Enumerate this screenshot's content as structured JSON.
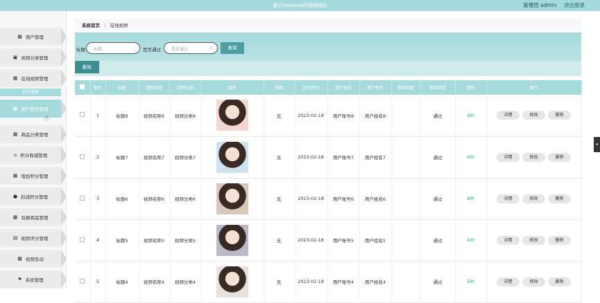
{
  "header": {
    "title": "基于Javaweb的视频网站",
    "user": "管理员 admin",
    "logout": "退出登录"
  },
  "sidebar": {
    "items": [
      {
        "label": "用户管理",
        "icon": "grid-icon"
      },
      {
        "label": "视频分类管理",
        "icon": "box-icon"
      },
      {
        "label": "在线视频管理",
        "icon": "grid-icon"
      },
      {
        "label": "用户积分管理",
        "icon": "grid-icon"
      },
      {
        "label": "商品分类管理",
        "icon": "grid-icon"
      },
      {
        "label": "积分商城管理",
        "icon": "shop-icon"
      },
      {
        "label": "增加积分管理",
        "icon": "grid-icon"
      },
      {
        "label": "扣减积分管理",
        "icon": "user-icon"
      },
      {
        "label": "兑换商品管理",
        "icon": "grid-icon"
      },
      {
        "label": "视频评分管理",
        "icon": "doc-icon"
      },
      {
        "label": "视频互动",
        "icon": "grid-icon"
      },
      {
        "label": "系统管理",
        "icon": "flag-icon"
      }
    ],
    "sub_label": "在线视频"
  },
  "breadcrumb": {
    "home": "系统首页",
    "sep": "⋮",
    "current": "在线视频"
  },
  "search": {
    "title_label": "标题",
    "title_placeholder": "标题",
    "pass_label": "是否通过",
    "pass_placeholder": "是否通过",
    "query": "查询"
  },
  "delete_label": "删除",
  "table": {
    "headers": [
      "索引",
      "标题",
      "视频名称",
      "视频分类",
      "图片",
      "视频",
      "发布时间",
      "用户账号",
      "用户姓名",
      "审核回复",
      "审核状态",
      "审核",
      "操作"
    ],
    "rows": [
      {
        "idx": "1",
        "title": "标题8",
        "name": "视频名称8",
        "cat": "视频分类8",
        "video": "无",
        "date": "2023-02-18",
        "acct": "用户账号8",
        "uname": "用户姓名8",
        "reply": "",
        "status": "通过",
        "audit": "审核"
      },
      {
        "idx": "2",
        "title": "标题7",
        "name": "视频名称7",
        "cat": "视频分类7",
        "video": "无",
        "date": "2023-02-18",
        "acct": "用户账号7",
        "uname": "用户姓名7",
        "reply": "",
        "status": "通过",
        "audit": "审核"
      },
      {
        "idx": "3",
        "title": "标题6",
        "name": "视频名称6",
        "cat": "视频分类6",
        "video": "无",
        "date": "2023-02-18",
        "acct": "用户账号6",
        "uname": "用户姓名6",
        "reply": "",
        "status": "通过",
        "audit": "审核"
      },
      {
        "idx": "4",
        "title": "标题5",
        "name": "视频名称5",
        "cat": "视频分类5",
        "video": "无",
        "date": "2023-02-18",
        "acct": "用户账号5",
        "uname": "用户姓名5",
        "reply": "",
        "status": "通过",
        "audit": "审核"
      },
      {
        "idx": "5",
        "title": "标题4",
        "name": "视频名称4",
        "cat": "视频分类4",
        "video": "无",
        "date": "2023-02-18",
        "acct": "用户账号4",
        "uname": "用户姓名4",
        "reply": "",
        "status": "通过",
        "audit": "审核"
      }
    ],
    "ops": {
      "detail": "详情",
      "edit": "修改",
      "delete": "删除"
    }
  }
}
